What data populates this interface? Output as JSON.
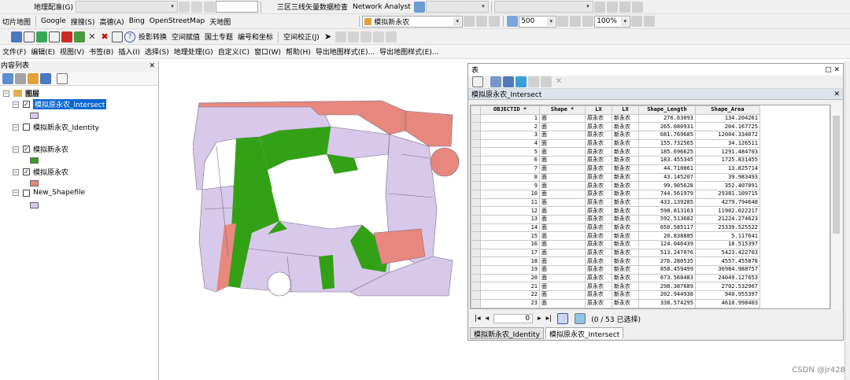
{
  "toolbar_row1": {
    "georef": "地理配准(G)",
    "tool_a": "三区三线矢量数据检查",
    "network": "Network Analyst"
  },
  "toolbar_row2": {
    "mapcut": "切片地图",
    "google": "Google",
    "sogou": "搜搜(S)",
    "gaode": "高德(A)",
    "bing": "Bing",
    "osm": "OpenStreetMap",
    "tianditu": "天地图",
    "layer_select": "模拟新永农",
    "scale": "500",
    "zoom": "100%"
  },
  "toolbar_row3": {
    "projection": "投影转换",
    "spatial_assign": "空间赋值",
    "land_topic": "国土专题",
    "number_coord": "编号和坐标",
    "spatial_correct": "空间校正(J)"
  },
  "menu": [
    "文件(F)",
    "编辑(E)",
    "视图(V)",
    "书签(B)",
    "插入(I)",
    "选择(S)",
    "地理处理(G)",
    "自定义(C)",
    "窗口(W)",
    "帮助(H)",
    "导出地图样式(E)...",
    "导出地图样式(E)..."
  ],
  "toc": {
    "title": "内容列表",
    "root": "图层",
    "layers": [
      {
        "name": "模拟原永农_Intersect",
        "checked": true,
        "color": "#d8c8ea"
      },
      {
        "name": "模拟新永农_Identity",
        "checked": false,
        "color": ""
      },
      {
        "name": "模拟新永农",
        "checked": true,
        "color": "#33a116"
      },
      {
        "name": "模拟原永农",
        "checked": true,
        "color": "#e8877d"
      },
      {
        "name": "New_Shapefile",
        "checked": false,
        "color": "#d8c8ea"
      }
    ]
  },
  "table_window": {
    "title": "表",
    "table_name": "模拟原永农_Intersect",
    "columns": [
      "OBJECTID *",
      "Shape *",
      "LX",
      "LX",
      "Shape_Length",
      "Shape_Area"
    ],
    "rows": [
      [
        "1",
        "面",
        "原永农",
        "新永农",
        "276.63093",
        "134.204261"
      ],
      [
        "2",
        "面",
        "原永农",
        "新永农",
        "265.080931",
        "204.167725"
      ],
      [
        "3",
        "面",
        "原永农",
        "新永农",
        "681.769685",
        "12004.334072"
      ],
      [
        "4",
        "面",
        "原永农",
        "新永农",
        "155.732565",
        "34.126511"
      ],
      [
        "5",
        "面",
        "原永农",
        "新永农",
        "185.696625",
        "1291.484703"
      ],
      [
        "6",
        "面",
        "原永农",
        "新永农",
        "183.455345",
        "1725.831455"
      ],
      [
        "7",
        "面",
        "原永农",
        "新永农",
        "44.710061",
        "13.825714"
      ],
      [
        "8",
        "面",
        "原永农",
        "新永农",
        "43.145207",
        "39.983493"
      ],
      [
        "9",
        "面",
        "原永农",
        "新永农",
        "99.905628",
        "352.407091"
      ],
      [
        "10",
        "面",
        "原永农",
        "新永农",
        "744.561979",
        "29381.109715"
      ],
      [
        "11",
        "面",
        "原永农",
        "新永农",
        "433.139285",
        "4279.794648"
      ],
      [
        "12",
        "面",
        "原永农",
        "新永农",
        "598.813163",
        "11902.022217"
      ],
      [
        "13",
        "面",
        "原永农",
        "新永农",
        "592.513682",
        "21224.274623"
      ],
      [
        "14",
        "面",
        "原永农",
        "新永农",
        "650.585117",
        "25339.525522"
      ],
      [
        "15",
        "面",
        "原永农",
        "新永农",
        "20.838885",
        "5.117641"
      ],
      [
        "16",
        "面",
        "原永农",
        "新永农",
        "124.046439",
        "18.515397"
      ],
      [
        "17",
        "面",
        "原永农",
        "新永农",
        "513.247076",
        "5423.422703"
      ],
      [
        "18",
        "面",
        "原永农",
        "新永农",
        "276.280535",
        "4557.455878"
      ],
      [
        "19",
        "面",
        "原永农",
        "新永农",
        "858.459499",
        "36984.988757"
      ],
      [
        "20",
        "面",
        "原永农",
        "新永农",
        "673.560483",
        "24049.127653"
      ],
      [
        "21",
        "面",
        "原永农",
        "新永农",
        "298.387689",
        "2702.532967"
      ],
      [
        "22",
        "面",
        "原永农",
        "新永农",
        "202.944938",
        "940.955397"
      ],
      [
        "23",
        "面",
        "原永农",
        "新永农",
        "338.574295",
        "4610.998403"
      ]
    ],
    "record": "0",
    "selection": "(0 / 53 已选择)",
    "tabs": [
      "模拟新永农_Identity",
      "模拟原永农_Intersect"
    ]
  },
  "watermark": "CSDN @jr428"
}
